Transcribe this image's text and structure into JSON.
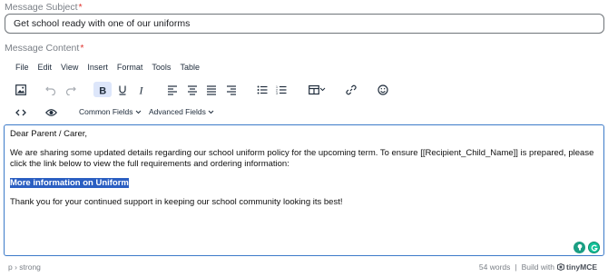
{
  "subject": {
    "label": "Message Subject",
    "required_marker": "*",
    "value": "Get school ready with one of our uniforms"
  },
  "content": {
    "label": "Message Content",
    "required_marker": "*"
  },
  "menubar": {
    "items": [
      "File",
      "Edit",
      "View",
      "Insert",
      "Format",
      "Tools",
      "Table"
    ]
  },
  "toolbar": {
    "common_fields_label": "Common Fields",
    "advanced_fields_label": "Advanced Fields",
    "bold_active": true
  },
  "editor_body": {
    "greeting": "Dear Parent / Carer,",
    "paragraph": "We are sharing some updated details regarding our school uniform policy for the upcoming term. To ensure [[Recipient_Child_Name]] is prepared, please click the link below to view the full requirements and ordering information:",
    "link_text": "More information on Uniform",
    "thanks": "Thank you for your continued support in keeping our school community looking its best!"
  },
  "statusbar": {
    "path": "p › strong",
    "word_count": "54 words",
    "build_with": "Build with",
    "brand": "tinyMCE"
  },
  "colors": {
    "accent": "#3d7bc9",
    "selection": "#2b5fc2",
    "required": "#e0332e"
  }
}
